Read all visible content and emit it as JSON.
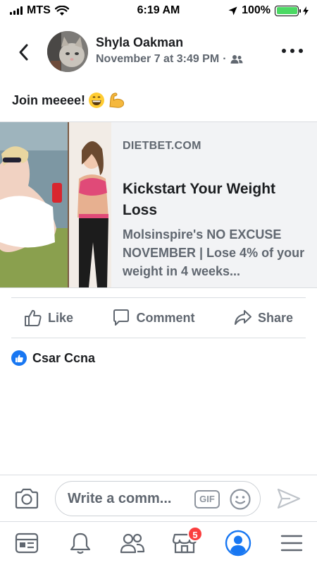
{
  "status_bar": {
    "carrier": "MTS",
    "time": "6:19 AM",
    "battery": "100%",
    "battery_level": 1.0
  },
  "post": {
    "author": "Shyla Oakman",
    "timestamp": "November 7 at 3:49 PM",
    "separator": "·",
    "audience_icon": "friends-icon",
    "text": "Join meeee!",
    "emojis": [
      "grinning-face",
      "flexed-biceps"
    ]
  },
  "link": {
    "domain": "DIETBET.COM",
    "title": "Kickstart Your Weight Loss",
    "description": "Molsinspire's NO EXCUSE NOVEMBER | Lose 4% of your weight in 4 weeks..."
  },
  "actions": {
    "like": "Like",
    "comment": "Comment",
    "share": "Share"
  },
  "reactions": {
    "name": "Csar Ccna"
  },
  "comment": {
    "placeholder": "Write a comm...",
    "gif": "GIF"
  },
  "tab_bar": {
    "items": [
      "feed-icon",
      "notifications-icon",
      "friends-icon",
      "marketplace-icon",
      "profile-icon",
      "menu-icon"
    ],
    "marketplace_badge": "5"
  },
  "colors": {
    "accent": "#1877f2",
    "battery": "#4cd964",
    "badge": "#fa3e3e",
    "secondary_text": "#606770"
  }
}
